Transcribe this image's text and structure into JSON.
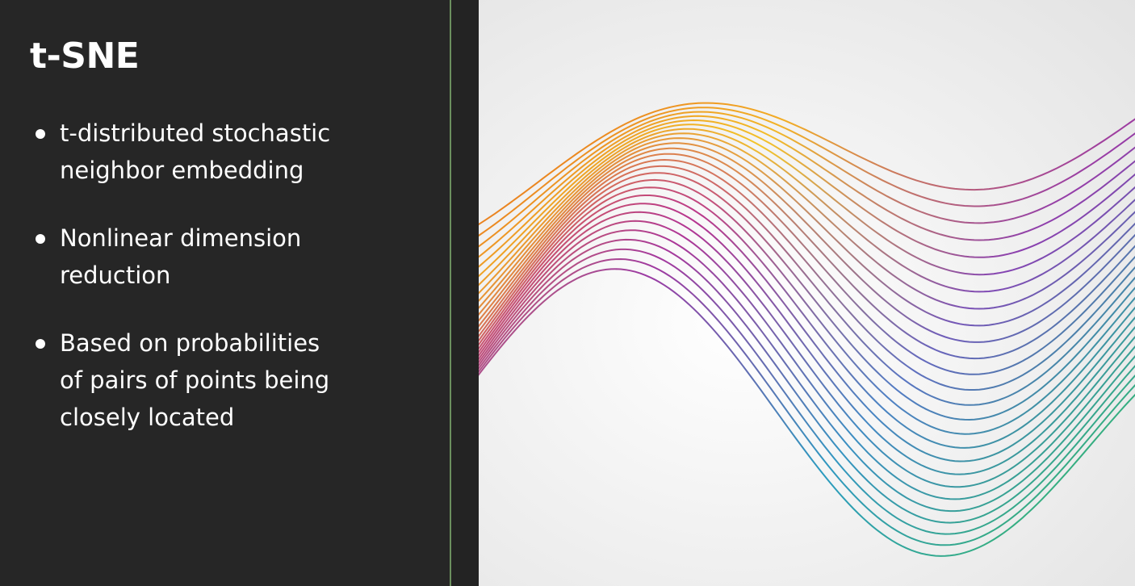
{
  "slide": {
    "title": "t-SNE",
    "bullets": [
      {
        "lines": [
          "t-distributed stochastic",
          "neighbor embedding"
        ]
      },
      {
        "lines": [
          "Nonlinear dimension",
          "reduction"
        ]
      },
      {
        "lines": [
          "Based on probabilities",
          "of pairs of points being",
          "closely located"
        ]
      }
    ]
  },
  "colors": {
    "left_background": "#262626",
    "divider": "#6b8f5e",
    "text": "#ffffff",
    "art_background": "#f2f2f2",
    "wave_palette": [
      "#d93a1c",
      "#f08a1c",
      "#f3c52a",
      "#b8338f",
      "#8a3fb0",
      "#4f7fc4",
      "#2b9bc0",
      "#23a87a",
      "#3dbb55"
    ]
  },
  "art": {
    "description_icon": "rainbow-wave-lines-decoration"
  }
}
